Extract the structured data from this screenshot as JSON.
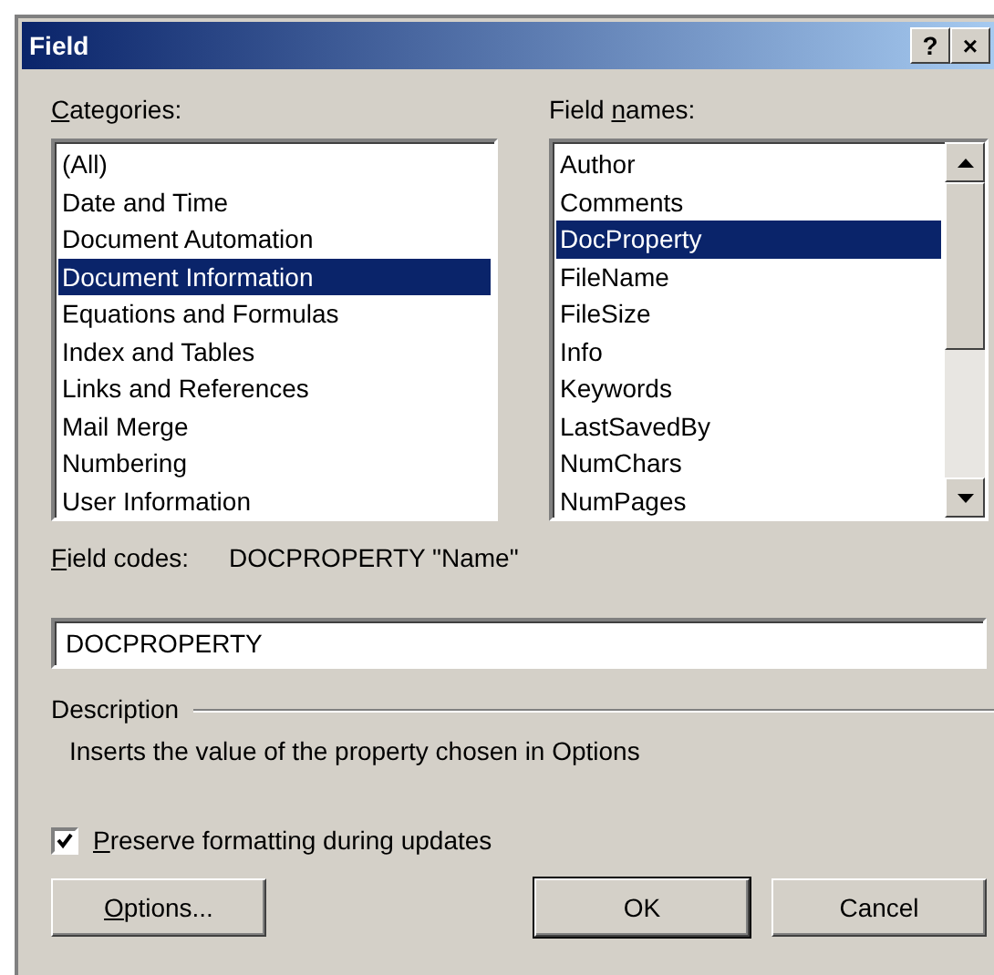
{
  "window": {
    "title": "Field",
    "buttons": [
      "?",
      "×"
    ]
  },
  "categories": {
    "label": {
      "key": "C",
      "post": "ategories:"
    },
    "items": [
      {
        "text": "(All)",
        "selected": false
      },
      {
        "text": "Date and Time",
        "selected": false
      },
      {
        "text": "Document Automation",
        "selected": false
      },
      {
        "text": "Document Information",
        "selected": true
      },
      {
        "text": "Equations and Formulas",
        "selected": false
      },
      {
        "text": "Index and Tables",
        "selected": false
      },
      {
        "text": "Links and References",
        "selected": false
      },
      {
        "text": "Mail Merge",
        "selected": false
      },
      {
        "text": "Numbering",
        "selected": false
      },
      {
        "text": "User Information",
        "selected": false
      }
    ]
  },
  "field_names": {
    "label": {
      "pre": "Field ",
      "key": "n",
      "post": "ames:"
    },
    "items": [
      {
        "text": "Author",
        "selected": false
      },
      {
        "text": "Comments",
        "selected": false
      },
      {
        "text": "DocProperty",
        "selected": true
      },
      {
        "text": "FileName",
        "selected": false
      },
      {
        "text": "FileSize",
        "selected": false
      },
      {
        "text": "Info",
        "selected": false
      },
      {
        "text": "Keywords",
        "selected": false
      },
      {
        "text": "LastSavedBy",
        "selected": false
      },
      {
        "text": "NumChars",
        "selected": false
      },
      {
        "text": "NumPages",
        "selected": false
      }
    ]
  },
  "field_codes": {
    "label": {
      "key": "F",
      "post": "ield codes:"
    },
    "value": "DOCPROPERTY \"Name\""
  },
  "code_input": {
    "value": "DOCPROPERTY"
  },
  "description": {
    "heading": "Description",
    "text": "Inserts the value of the property chosen in Options"
  },
  "preserve": {
    "label": {
      "key": "P",
      "post": "reserve formatting during updates"
    },
    "checked": true
  },
  "buttons": [
    {
      "label": {
        "key": "O",
        "post": "ptions..."
      },
      "kind": "left",
      "default": false
    },
    {
      "label": {
        "post": "OK"
      },
      "kind": "right",
      "default": true
    },
    {
      "label": {
        "post": "Cancel"
      },
      "kind": "right",
      "default": false
    }
  ]
}
